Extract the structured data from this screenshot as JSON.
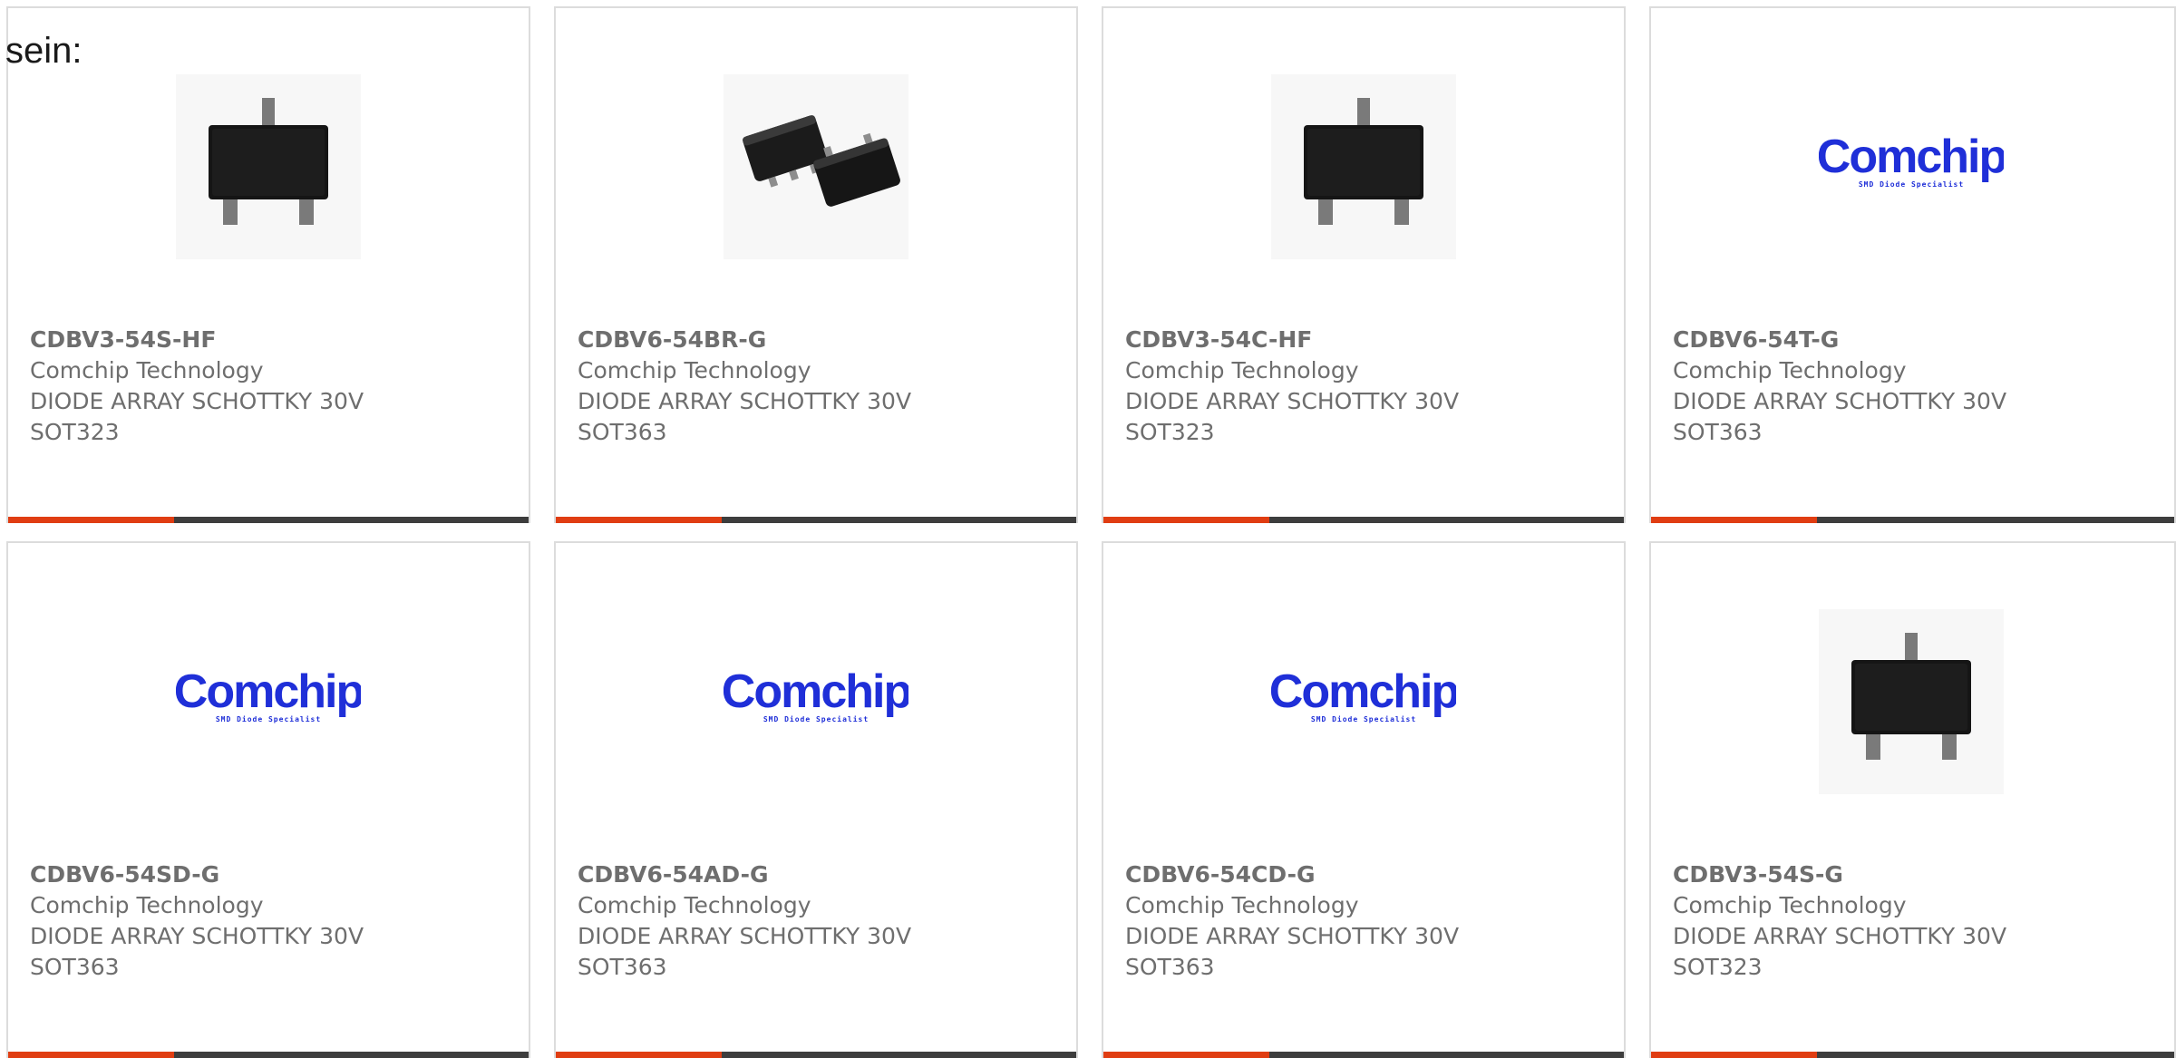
{
  "intro_text": "sein:",
  "colors": {
    "accent": "#e03d12",
    "bar": "#3d3d3d",
    "logo_blue": "#1f2fd8"
  },
  "products": [
    {
      "part": "CDBV3-54S-HF",
      "maker": "Comchip Technology",
      "desc": "DIODE ARRAY SCHOTTKY 30V",
      "pkg": "SOT323",
      "image": "sot323-chip"
    },
    {
      "part": "CDBV6-54BR-G",
      "maker": "Comchip Technology",
      "desc": "DIODE ARRAY SCHOTTKY 30V",
      "pkg": "SOT363",
      "image": "sot363-chips"
    },
    {
      "part": "CDBV3-54C-HF",
      "maker": "Comchip Technology",
      "desc": "DIODE ARRAY SCHOTTKY 30V",
      "pkg": "SOT323",
      "image": "sot323-chip"
    },
    {
      "part": "CDBV6-54T-G",
      "maker": "Comchip Technology",
      "desc": "DIODE ARRAY SCHOTTKY 30V",
      "pkg": "SOT363",
      "image": "comchip-logo"
    },
    {
      "part": "CDBV6-54SD-G",
      "maker": "Comchip Technology",
      "desc": "DIODE ARRAY SCHOTTKY 30V",
      "pkg": "SOT363",
      "image": "comchip-logo"
    },
    {
      "part": "CDBV6-54AD-G",
      "maker": "Comchip Technology",
      "desc": "DIODE ARRAY SCHOTTKY 30V",
      "pkg": "SOT363",
      "image": "comchip-logo"
    },
    {
      "part": "CDBV6-54CD-G",
      "maker": "Comchip Technology",
      "desc": "DIODE ARRAY SCHOTTKY 30V",
      "pkg": "SOT363",
      "image": "comchip-logo"
    },
    {
      "part": "CDBV3-54S-G",
      "maker": "Comchip Technology",
      "desc": "DIODE ARRAY SCHOTTKY 30V",
      "pkg": "SOT323",
      "image": "sot323-chip"
    }
  ],
  "logo": {
    "word": "Comchip",
    "tagline": "SMD Diode Specialist"
  }
}
